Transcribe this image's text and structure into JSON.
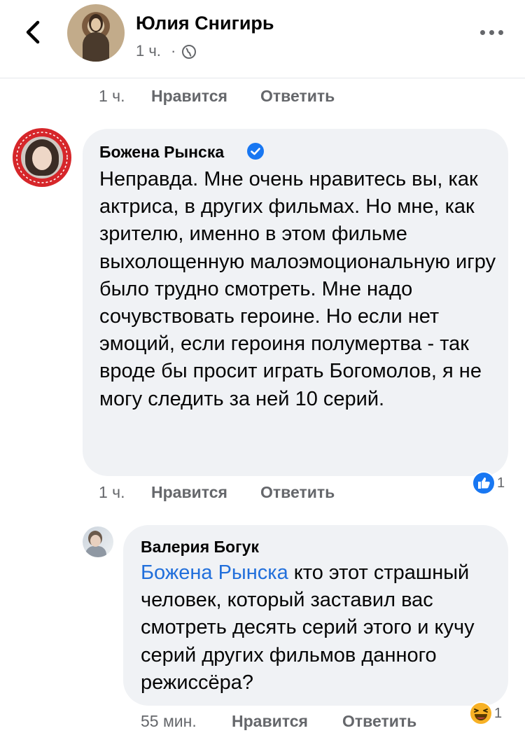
{
  "header": {
    "author": "Юлия Снигирь",
    "time": "1 ч.",
    "dot": "·"
  },
  "top_actions": {
    "time": "1 ч.",
    "like": "Нравится",
    "reply": "Ответить"
  },
  "comments": [
    {
      "author": "Божена Рынска",
      "verified": true,
      "text": "Неправда. Мне очень нравитесь вы, как актриса, в других фильмах. Но мне, как зрителю, именно в этом фильме выхолощенную малоэмоциональную игру было трудно смотреть. Мне надо сочувствовать героине. Но если нет эмоций, если героиня полумертва - так вроде бы просит играть Богомолов, я не могу следить за ней 10 серий.",
      "time": "1 ч.",
      "like": "Нравится",
      "reply": "Ответить",
      "reaction": {
        "icon": "like-reaction-icon",
        "count": "1",
        "color": "#1877f2"
      }
    },
    {
      "author": "Валерия Богук",
      "mention": "Божена Рынска",
      "text": "кто этот страшный человек, который заставил вас смотреть десять серий этого и кучу серий других фильмов данного режиссёра?",
      "time": "55 мин.",
      "like": "Нравится",
      "reply": "Ответить",
      "reaction": {
        "icon": "haha-reaction-icon",
        "count": "1",
        "color": "#f7b125"
      }
    }
  ],
  "colors": {
    "link": "#216fdb",
    "muted": "#65676b",
    "bubble": "#f0f2f5",
    "verified": "#1877f2"
  }
}
